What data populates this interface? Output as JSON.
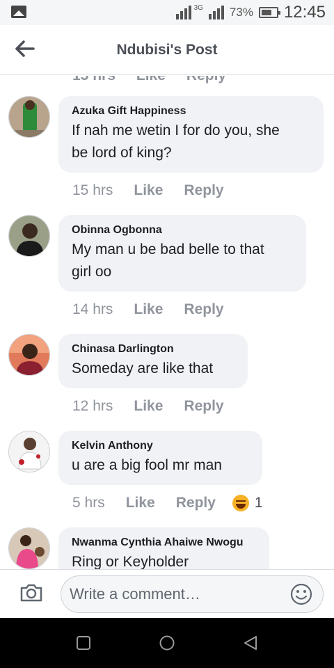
{
  "status_bar": {
    "battery": "73%",
    "time": "12:45",
    "network": "3G"
  },
  "header": {
    "title": "Ndubisi's Post"
  },
  "partial_actions": {
    "time": "15 hrs",
    "like": "Like",
    "reply": "Reply"
  },
  "comments": [
    {
      "author": "Azuka Gift Happiness",
      "text_lines": [
        "If nah me wetin I for do you, she",
        "be lord of king?"
      ],
      "time": "15 hrs",
      "like": "Like",
      "reply": "Reply"
    },
    {
      "author": "Obinna Ogbonna",
      "text_lines": [
        "My man u be bad belle to that",
        "girl oo"
      ],
      "time": "14 hrs",
      "like": "Like",
      "reply": "Reply"
    },
    {
      "author": "Chinasa Darlington",
      "text_lines": [
        "Someday are like that"
      ],
      "time": "12 hrs",
      "like": "Like",
      "reply": "Reply"
    },
    {
      "author": "Kelvin Anthony",
      "text_lines": [
        "u are a big fool mr man"
      ],
      "time": "5 hrs",
      "like": "Like",
      "reply": "Reply",
      "reaction_count": "1"
    },
    {
      "author": "Nwanma Cynthia Ahaiwe Nwogu",
      "text_lines": [
        "Ring or Keyholder"
      ]
    }
  ],
  "composer": {
    "placeholder": "Write a comment…"
  },
  "colors": {
    "bubble": "#f0f2f5",
    "meta": "#90949c",
    "title": "#4b4f56"
  },
  "icons": [
    "image-icon",
    "signal-icon",
    "battery-icon",
    "back-arrow-icon",
    "camera-icon",
    "emoji-icon",
    "haha-reaction-icon",
    "recents-icon",
    "home-icon",
    "back-nav-icon"
  ]
}
